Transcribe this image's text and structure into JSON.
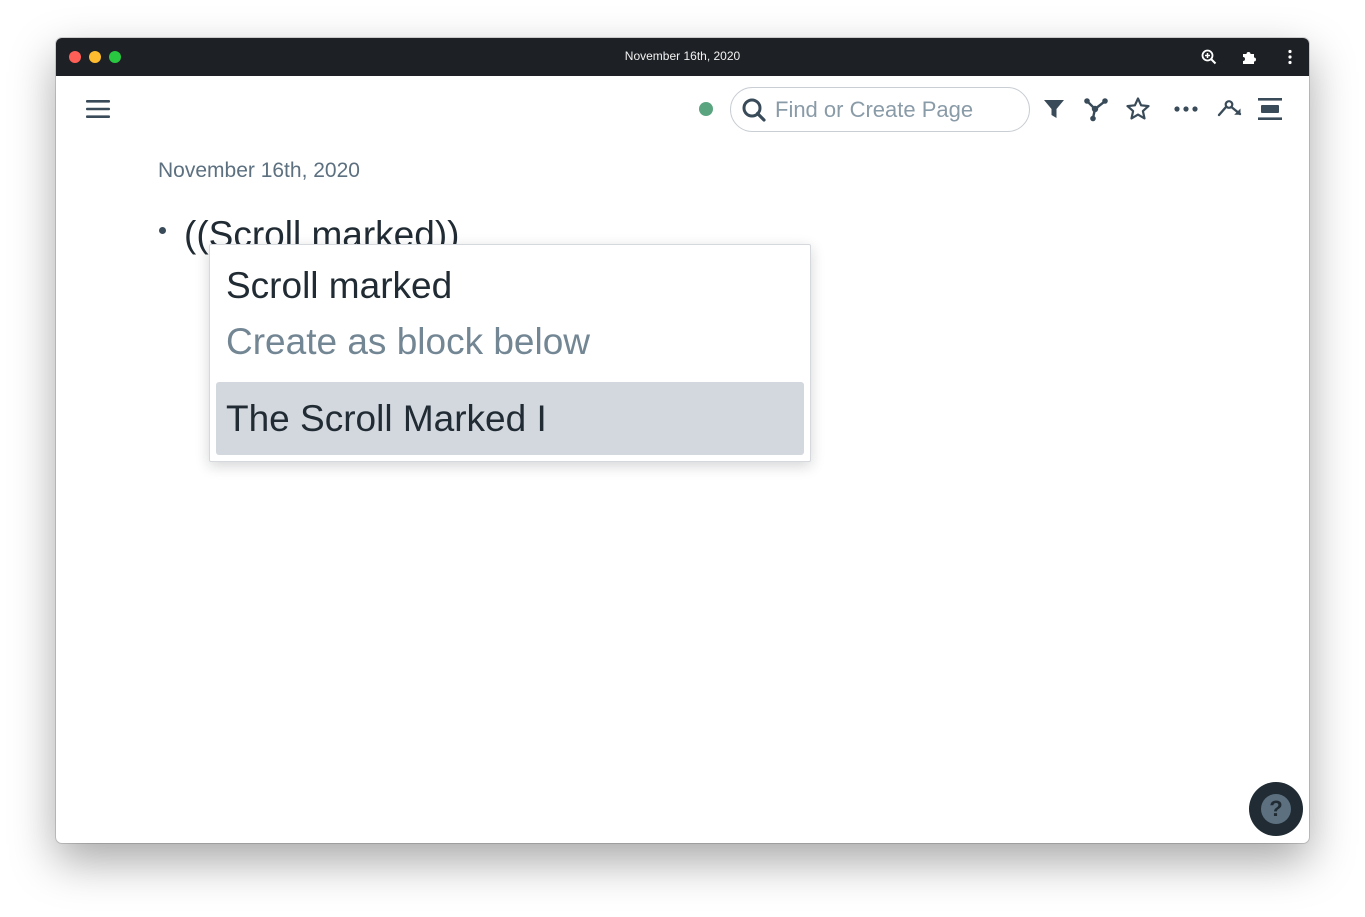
{
  "window": {
    "title": "November 16th, 2020",
    "titlebar_icons": [
      "zoom-in-icon",
      "puzzle-extension-icon",
      "more-vertical-icon"
    ]
  },
  "topbar": {
    "menu_icon": "hamburger-menu-icon",
    "sync_status_color": "#5aa57f",
    "search": {
      "placeholder": "Find or Create Page",
      "value": ""
    },
    "tools": [
      "filter-icon",
      "graph-icon",
      "star-icon",
      "more-horizontal-icon",
      "share-icon",
      "right-sidebar-icon"
    ]
  },
  "page": {
    "title": "November 16th, 2020",
    "blocks": [
      {
        "text": "((Scroll marked))"
      }
    ]
  },
  "autocomplete": {
    "items": [
      {
        "label": "Scroll marked",
        "type": "query"
      },
      {
        "label": "Create as block below",
        "type": "action"
      },
      {
        "label": "The Scroll Marked I",
        "type": "result",
        "selected": true
      }
    ]
  },
  "help": {
    "label": "?"
  }
}
